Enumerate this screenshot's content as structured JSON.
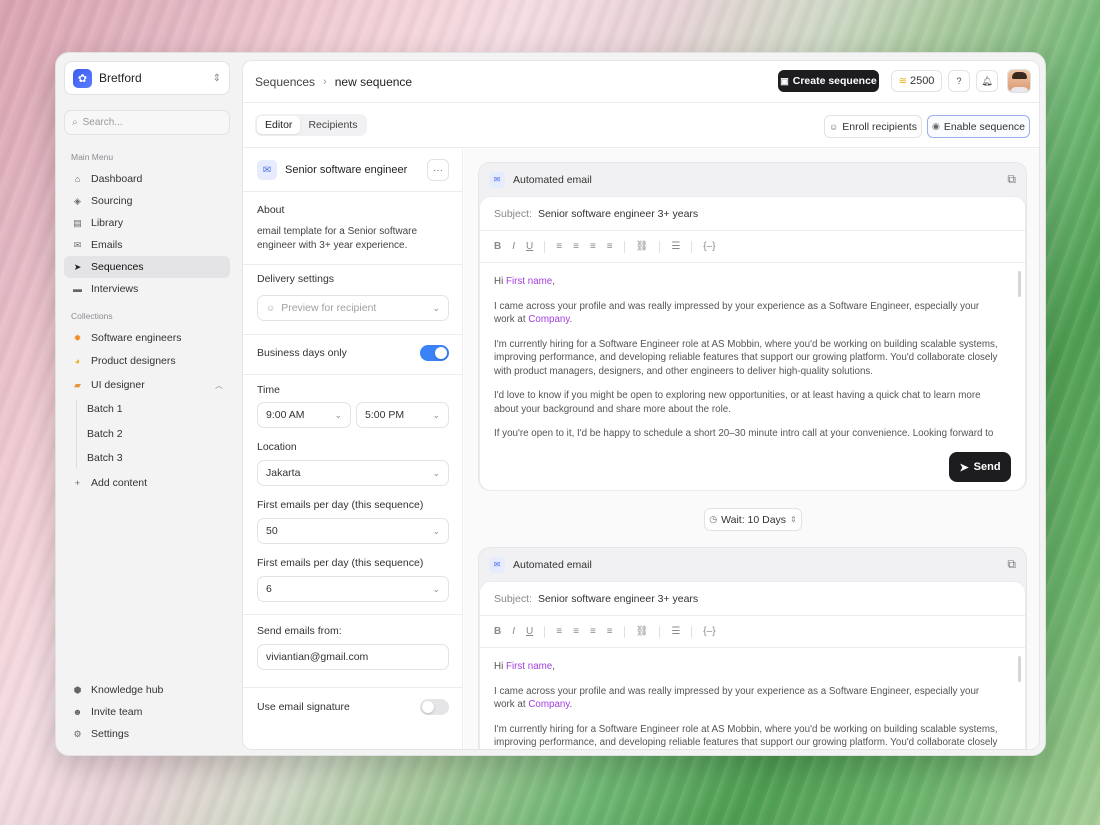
{
  "workspace": {
    "name": "Bretford"
  },
  "search": {
    "placeholder": "Search..."
  },
  "sidebar": {
    "main_menu_label": "Main Menu",
    "main_items": [
      {
        "label": "Dashboard",
        "icon": "home-icon"
      },
      {
        "label": "Sourcing",
        "icon": "sourcing-icon"
      },
      {
        "label": "Library",
        "icon": "library-icon"
      },
      {
        "label": "Emails",
        "icon": "mail-icon"
      },
      {
        "label": "Sequences",
        "icon": "send-icon",
        "active": true
      },
      {
        "label": "Interviews",
        "icon": "chat-icon"
      }
    ],
    "collections_label": "Collections",
    "collections": [
      {
        "label": "Software engineers",
        "icon": "orange-gear-icon",
        "color": "#f08a24"
      },
      {
        "label": "Product designers",
        "icon": "pie-icon",
        "color": "#e9b31c"
      },
      {
        "label": "UI designer",
        "icon": "folder-icon",
        "color": "#e8963a"
      }
    ],
    "sub_items": [
      "Batch 1",
      "Batch 2",
      "Batch 3"
    ],
    "add_content": "Add content",
    "bottom_items": [
      {
        "label": "Knowledge hub",
        "icon": "cube-icon"
      },
      {
        "label": "Invite team",
        "icon": "user-plus-icon"
      },
      {
        "label": "Settings",
        "icon": "gear-icon"
      }
    ]
  },
  "header": {
    "breadcrumb": [
      "Sequences",
      "new sequence"
    ],
    "create_button": "Create sequence",
    "credits": "2500"
  },
  "tabs": [
    "Editor",
    "Recipients"
  ],
  "actions": {
    "enroll": "Enroll recipients",
    "enable": "Enable sequence"
  },
  "panel": {
    "title": "Senior software engineer",
    "about_label": "About",
    "about_text": "email template for a Senior software engineer with 3+ year experience.",
    "delivery_label": "Delivery settings",
    "preview_placeholder": "Preview for recipient",
    "business_days_label": "Business days only",
    "business_days_on": true,
    "time_label": "Time",
    "time_start": "9:00 AM",
    "time_end": "5:00 PM",
    "location_label": "Location",
    "location": "Jakarta",
    "first_emails_label_1": "First emails per day (this sequence)",
    "first_emails_value_1": "50",
    "first_emails_label_2": "First emails per day (this sequence)",
    "first_emails_value_2": "6",
    "send_from_label": "Send emails from:",
    "send_from": "viviantian@gmail.com",
    "signature_label": "Use email signature",
    "signature_on": false
  },
  "emails": [
    {
      "title": "Automated email",
      "subject_label": "Subject:",
      "subject": "Senior software engineer 3+ years",
      "greeting_prefix": "Hi ",
      "greeting_var": "First name",
      "greeting_suffix": ",",
      "p1": "I came across your profile and was really impressed by your experience as a Software Engineer, especially your work at ",
      "p1_var": "Company",
      "p1_suffix": ".",
      "p2": "I'm currently hiring for a Software Engineer role at AS Mobbin, where you'd be working on building scalable systems, improving performance, and developing reliable features that support our growing platform. You'd collaborate closely with product managers, designers, and other engineers to deliver high-quality solutions.",
      "p3": "I'd love to know if you might be open to exploring new opportunities, or at least having a quick chat to learn more about your background and share more about the role.",
      "p4": "If you're open to it, I'd be happy to schedule a short 20–30 minute intro call at your convenience. Looking forward to",
      "send": "Send"
    },
    {
      "title": "Automated email",
      "subject_label": "Subject:",
      "subject": "Senior software engineer 3+ years",
      "greeting_prefix": "Hi ",
      "greeting_var": "First name",
      "greeting_suffix": ",",
      "p1": "I came across your profile and was really impressed by your experience as a Software Engineer, especially your work at ",
      "p1_var": "Company",
      "p1_suffix": ".",
      "p2": "I'm currently hiring for a Software Engineer role at AS Mobbin, where you'd be working on building scalable systems, improving performance, and developing reliable features that support our growing platform. You'd collaborate closely"
    }
  ],
  "wait": "Wait: 10 Days",
  "toolbar_icons": [
    "bold-icon",
    "italic-icon",
    "underline-icon",
    "align-left-icon",
    "align-center-icon",
    "align-right-icon",
    "align-justify-icon",
    "link-icon",
    "list-icon",
    "variable-icon"
  ]
}
